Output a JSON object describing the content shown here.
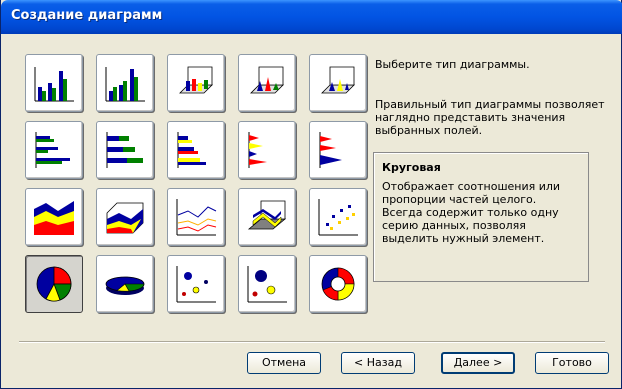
{
  "window": {
    "title": "Создание диаграмм"
  },
  "prompt": "Выберите тип диаграммы.",
  "description": "Правильный тип диаграммы позволяет наглядно представить значения выбранных полей.",
  "info": {
    "title": "Круговая",
    "text": "Отображает соотношения или пропорции частей целого. Всегда содержит только одну серию данных, позволяя выделить нужный элемент."
  },
  "buttons": {
    "cancel": "Отмена",
    "back": "< Назад",
    "next": "Далее >",
    "finish": "Готово"
  },
  "chart_types": [
    {
      "icon": "column-clustered-icon"
    },
    {
      "icon": "column-stacked-icon"
    },
    {
      "icon": "column-3d-icon"
    },
    {
      "icon": "column-3d-clustered-icon"
    },
    {
      "icon": "cone-3d-icon"
    },
    {
      "icon": "bar-clustered-icon"
    },
    {
      "icon": "bar-stacked-icon"
    },
    {
      "icon": "bar-stacked-percent-icon"
    },
    {
      "icon": "pyramid-bar-icon"
    },
    {
      "icon": "cone-bar-icon"
    },
    {
      "icon": "area-icon"
    },
    {
      "icon": "area-3d-icon"
    },
    {
      "icon": "line-icon"
    },
    {
      "icon": "line-3d-icon"
    },
    {
      "icon": "scatter-icon"
    },
    {
      "icon": "pie-icon",
      "selected": true
    },
    {
      "icon": "pie-3d-icon"
    },
    {
      "icon": "bubble-icon"
    },
    {
      "icon": "bubble-3d-icon"
    },
    {
      "icon": "doughnut-icon"
    }
  ],
  "colors": {
    "title_bar": "#0254e3",
    "dialog_bg": "#ece9d8",
    "palette": [
      "#0000a0",
      "#008000",
      "#ffff00",
      "#ff0000",
      "#00a0c0"
    ]
  }
}
